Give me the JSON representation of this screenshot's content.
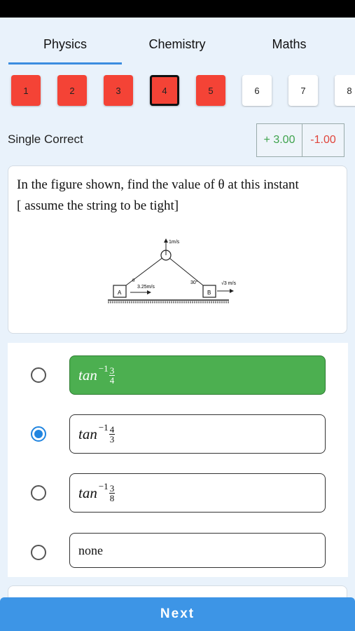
{
  "tabs": [
    {
      "label": "Physics",
      "active": true
    },
    {
      "label": "Chemistry",
      "active": false
    },
    {
      "label": "Maths",
      "active": false
    }
  ],
  "question_nav": [
    {
      "label": "1",
      "status": "red"
    },
    {
      "label": "2",
      "status": "red"
    },
    {
      "label": "3",
      "status": "red"
    },
    {
      "label": "4",
      "status": "red",
      "current": true
    },
    {
      "label": "5",
      "status": "red"
    },
    {
      "label": "6",
      "status": "white"
    },
    {
      "label": "7",
      "status": "white"
    },
    {
      "label": "8",
      "status": "white"
    }
  ],
  "question": {
    "type": "Single Correct",
    "positive_marks": "+ 3.00",
    "negative_marks": "-1.00",
    "text_line1": "In the figure shown, find the value of θ at this instant",
    "text_line2": "[ assume the string to be tight]",
    "figure": {
      "label_top": "1m/s",
      "label_theta": "θ",
      "label_left_speed": "3.25m/s",
      "label_angle": "30°",
      "label_right_speed": "√3 m/s",
      "block_a": "A",
      "block_b": "B"
    }
  },
  "options": [
    {
      "func": "tan",
      "sup": "−1",
      "num": "3",
      "den": "4",
      "state": "correct",
      "selected": false
    },
    {
      "func": "tan",
      "sup": "−1",
      "num": "4",
      "den": "3",
      "state": "normal",
      "selected": true
    },
    {
      "func": "tan",
      "sup": "−1",
      "num": "3",
      "den": "8",
      "state": "normal",
      "selected": false
    },
    {
      "plain": "none",
      "state": "normal",
      "selected": false
    }
  ],
  "next_label": "Next",
  "colors": {
    "accent": "#3d95e6",
    "correct": "#4caf50",
    "attempted": "#f44336",
    "positive": "#3fa34d",
    "negative": "#e0453b"
  }
}
